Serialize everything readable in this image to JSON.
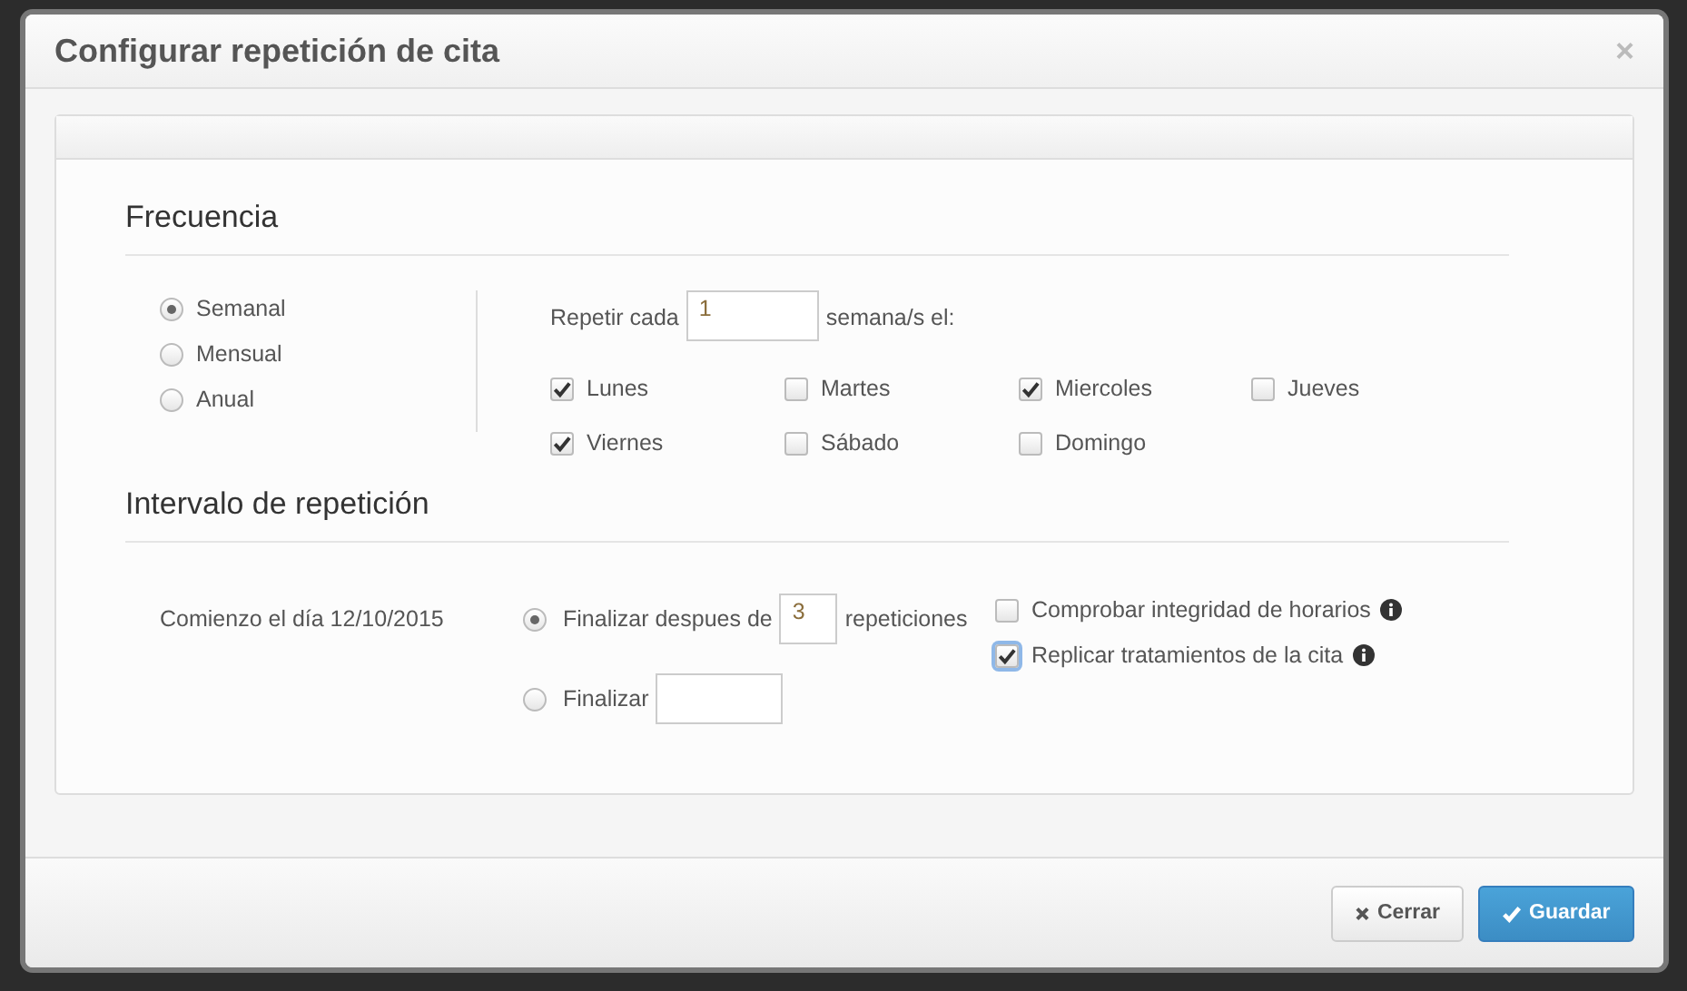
{
  "dialog": {
    "title": "Configurar repetición de cita",
    "close": "×"
  },
  "frequency": {
    "heading": "Frecuencia",
    "options": [
      {
        "label": "Semanal",
        "selected": true
      },
      {
        "label": "Mensual",
        "selected": false
      },
      {
        "label": "Anual",
        "selected": false
      }
    ],
    "repeat_label": "Repetir cada",
    "repeat_value": "1",
    "repeat_unit": "semana/s el:",
    "days": [
      {
        "label": "Lunes",
        "checked": true
      },
      {
        "label": "Martes",
        "checked": false
      },
      {
        "label": "Miercoles",
        "checked": true
      },
      {
        "label": "Jueves",
        "checked": false
      },
      {
        "label": "Viernes",
        "checked": true
      },
      {
        "label": "Sábado",
        "checked": false
      },
      {
        "label": "Domingo",
        "checked": false
      }
    ]
  },
  "interval": {
    "heading": "Intervalo de repetición",
    "start": "Comienzo el día 12/10/2015",
    "end_after": {
      "label": "Finalizar despues de",
      "value": "3",
      "unit": "repeticiones",
      "selected": true
    },
    "end_on": {
      "label": "Finalizar",
      "selected": false
    },
    "options": [
      {
        "label": "Comprobar integridad de horarios",
        "checked": false
      },
      {
        "label": "Replicar tratamientos de la cita",
        "checked": true
      }
    ]
  },
  "buttons": [
    {
      "label": "Cerrar",
      "kind": "default"
    },
    {
      "label": "Guardar",
      "kind": "primary"
    }
  ]
}
